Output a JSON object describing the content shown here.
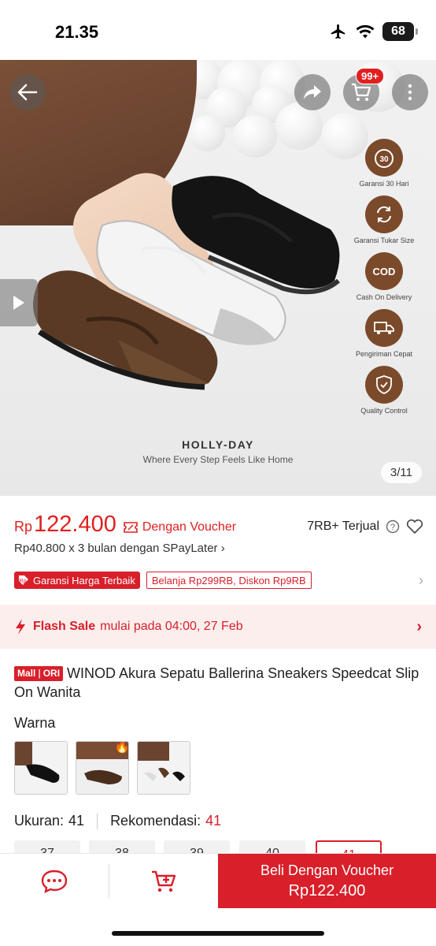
{
  "status_bar": {
    "time": "21.35",
    "battery": "68"
  },
  "hero": {
    "cart_badge": "99+",
    "features": [
      {
        "icon": "clock-30-icon",
        "glyph": "30",
        "label": "Garansi 30 Hari"
      },
      {
        "icon": "exchange-icon",
        "glyph": "",
        "label": "Garansi Tukar Size"
      },
      {
        "icon": "cod-icon",
        "glyph": "COD",
        "label": "Cash On Delivery"
      },
      {
        "icon": "truck-icon",
        "glyph": "",
        "label": "Pengiriman Cepat"
      },
      {
        "icon": "shield-check-icon",
        "glyph": "",
        "label": "Quality Control"
      }
    ],
    "brand_title": "HOLLY-DAY",
    "brand_subtitle": "Where Every Step Feels Like Home",
    "image_counter": "3/11"
  },
  "price": {
    "currency": "Rp",
    "amount": "122.400",
    "voucher_label": "Dengan Voucher",
    "sold": "7RB+ Terjual",
    "spaylater": "Rp40.800 x 3 bulan dengan SPayLater"
  },
  "badges": {
    "garansi": "Garansi Harga Terbaik",
    "diskon": "Belanja Rp299RB, Diskon Rp9RB"
  },
  "flash_sale": {
    "title": "Flash Sale",
    "subtitle": "mulai pada 04:00, 27 Feb"
  },
  "product": {
    "mall_tag": "Mall",
    "ori_tag": "ORI",
    "title": "WINOD Akura Sepatu Ballerina Sneakers Speedcat Slip On Wanita"
  },
  "variants": {
    "warna_label": "Warna",
    "ukuran_label": "Ukuran:",
    "ukuran_value": "41",
    "rekomendasi_label": "Rekomendasi:",
    "rekomendasi_value": "41",
    "sizes": [
      "37",
      "38",
      "39",
      "40",
      "41"
    ]
  },
  "bottom_bar": {
    "buy_label": "Beli Dengan Voucher",
    "buy_price": "Rp122.400"
  },
  "colors": {
    "accent": "#d81f2a",
    "feature_brown": "#7b4a2a"
  }
}
